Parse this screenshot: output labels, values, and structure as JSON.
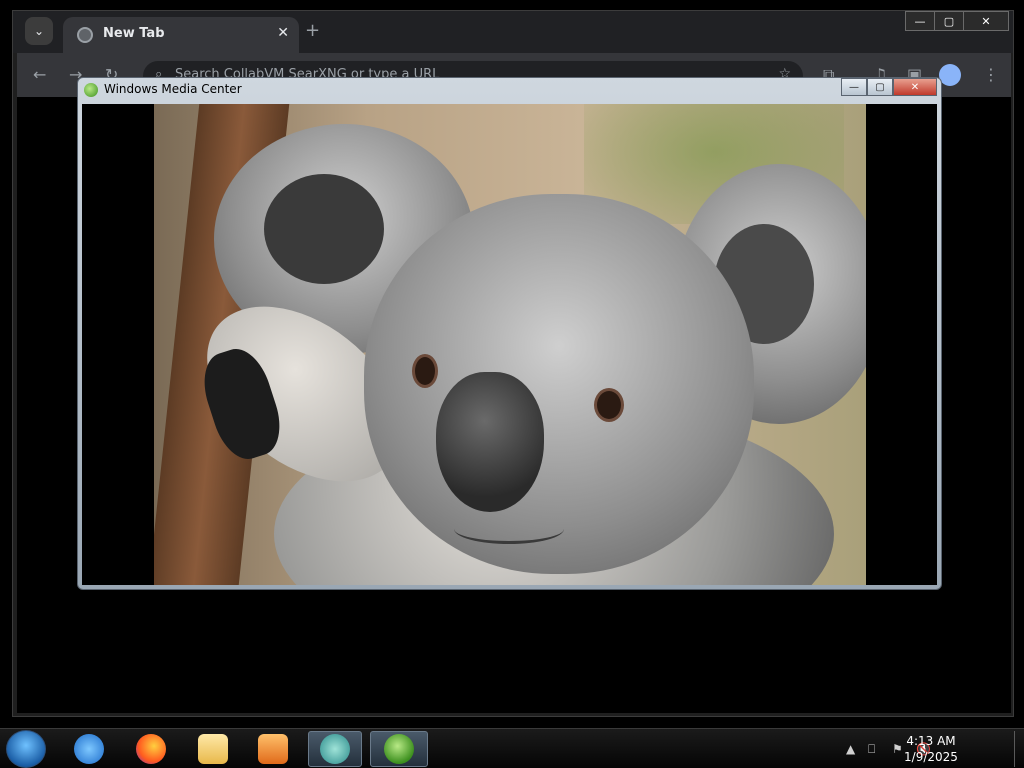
{
  "browser": {
    "tab_title": "New Tab",
    "tab_close_glyph": "✕",
    "new_tab_glyph": "+",
    "omnibox_placeholder": "Search CollabVM SearXNG or type a URL",
    "window_controls": {
      "minimize": "—",
      "maximize": "▢",
      "close": "✕"
    }
  },
  "media_center": {
    "title": "Windows Media Center",
    "controls": {
      "minimize": "—",
      "maximize": "▢",
      "close": "✕"
    },
    "photo_subject": "koala"
  },
  "taskbar": {
    "apps": [
      {
        "name": "internet-explorer-icon"
      },
      {
        "name": "firefox-icon"
      },
      {
        "name": "file-explorer-icon"
      },
      {
        "name": "media-player-icon"
      },
      {
        "name": "chrome-taskbar-icon"
      },
      {
        "name": "media-center-taskbar-icon"
      }
    ],
    "clock_time": "4:13 AM",
    "clock_date": "1/9/2025",
    "tray_arrow": "▲"
  }
}
